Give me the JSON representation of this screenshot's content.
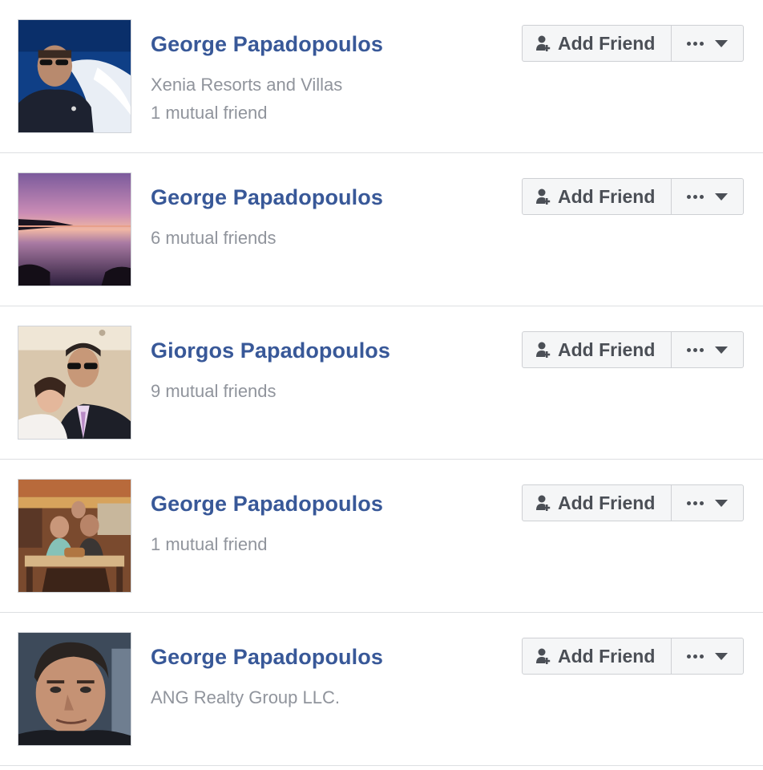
{
  "results": [
    {
      "name": "George Papadopoulos",
      "details": [
        "Xenia Resorts and Villas",
        "1 mutual friend"
      ],
      "photo": "man-with-sunglasses-on-boat",
      "add_label": "Add Friend"
    },
    {
      "name": "George Papadopoulos",
      "details": [
        "6 mutual friends",
        ""
      ],
      "photo": "purple-sunset-over-water",
      "add_label": "Add Friend"
    },
    {
      "name": "Giorgos Papadopoulos",
      "details": [
        "9 mutual friends",
        ""
      ],
      "photo": "man-and-girl-selfie",
      "add_label": "Add Friend"
    },
    {
      "name": "George Papadopoulos",
      "details": [
        "1 mutual friend",
        ""
      ],
      "photo": "group-at-restaurant",
      "add_label": "Add Friend"
    },
    {
      "name": "George Papadopoulos",
      "details": [
        "ANG Realty Group LLC.",
        ""
      ],
      "photo": "man-portrait-closeup",
      "add_label": "Add Friend"
    }
  ],
  "icons": {
    "add_friend": "add-friend-icon",
    "more": "more-dots-icon",
    "dropdown": "caret-down-icon"
  },
  "colors": {
    "name_link": "#385898",
    "secondary_text": "#90949c",
    "button_bg": "#f5f6f7",
    "button_border": "#ced0d4",
    "button_text": "#4b4f56",
    "divider": "#dddfe2"
  }
}
